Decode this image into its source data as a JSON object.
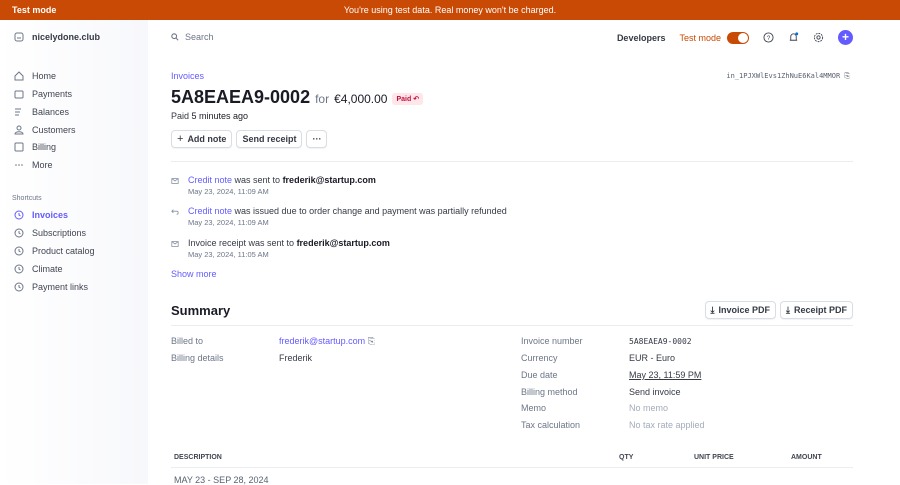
{
  "banner": {
    "label": "Test mode",
    "message": "You're using test data. Real money won't be charged."
  },
  "sidebar": {
    "account": "nicelydone.club",
    "items": [
      {
        "label": "Home",
        "icon": "home-icon"
      },
      {
        "label": "Payments",
        "icon": "wallet-icon"
      },
      {
        "label": "Balances",
        "icon": "balances-icon"
      },
      {
        "label": "Customers",
        "icon": "person-icon"
      },
      {
        "label": "Billing",
        "icon": "billing-icon"
      },
      {
        "label": "More",
        "icon": "more-icon"
      }
    ],
    "shortcuts_title": "Shortcuts",
    "shortcuts": [
      {
        "label": "Invoices",
        "active": true
      },
      {
        "label": "Subscriptions"
      },
      {
        "label": "Product catalog"
      },
      {
        "label": "Climate"
      },
      {
        "label": "Payment links"
      }
    ]
  },
  "topbar": {
    "search_placeholder": "Search",
    "developers": "Developers",
    "test_mode": "Test mode"
  },
  "invoice": {
    "breadcrumb": "Invoices",
    "id": "in_1PJXWlEvs1ZhNuE6Kal4MMOR",
    "number": "5A8EAEA9-0002",
    "for": "for",
    "amount": "€4,000.00",
    "status": "Paid",
    "paid_ago_prefix": "Paid",
    "paid_ago": "5 minutes ago"
  },
  "actions": {
    "add_note": "Add note",
    "send_receipt": "Send receipt",
    "more": "···"
  },
  "timeline": [
    {
      "link": "Credit note",
      "text": " was sent to ",
      "bold": "frederik@startup.com",
      "date": "May 23, 2024, 11:09 AM"
    },
    {
      "link": "Credit note",
      "text": " was issued due to order change and payment was partially refunded",
      "bold": "",
      "date": "May 23, 2024, 11:09 AM"
    },
    {
      "link": "",
      "text": "Invoice receipt was sent to ",
      "bold": "frederik@startup.com",
      "date": "May 23, 2024, 11:05 AM"
    }
  ],
  "show_more": "Show more",
  "summary": {
    "title": "Summary",
    "invoice_pdf": "Invoice PDF",
    "receipt_pdf": "Receipt PDF",
    "billed_to_label": "Billed to",
    "billed_to": "frederik@startup.com",
    "billing_details_label": "Billing details",
    "billing_details": "Frederik",
    "fields": [
      {
        "k": "Invoice number",
        "v": "5A8EAEA9-0002"
      },
      {
        "k": "Currency",
        "v": "EUR - Euro"
      },
      {
        "k": "Due date",
        "v": "May 23, 11:59 PM"
      },
      {
        "k": "Billing method",
        "v": "Send invoice"
      },
      {
        "k": "Memo",
        "v": "No memo"
      },
      {
        "k": "Tax calculation",
        "v": "No tax rate applied"
      }
    ]
  },
  "table": {
    "headers": [
      "DESCRIPTION",
      "QTY",
      "UNIT PRICE",
      "AMOUNT"
    ],
    "period": "MAY 23 - SEP 28, 2024"
  },
  "colors": {
    "accent": "#635bff",
    "test_mode": "#c94a04"
  }
}
